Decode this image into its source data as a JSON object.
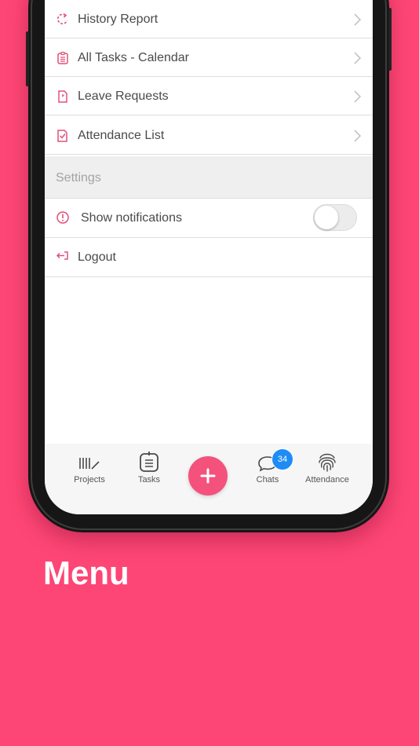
{
  "menu": {
    "items": [
      {
        "label": "History Report",
        "icon": "history-icon"
      },
      {
        "label": "All Tasks - Calendar",
        "icon": "calendar-icon"
      },
      {
        "label": "Leave Requests",
        "icon": "leave-document-icon"
      },
      {
        "label": "Attendance List",
        "icon": "checklist-icon"
      }
    ],
    "settings_header": "Settings",
    "notifications_label": "Show notifications",
    "notifications_enabled": false,
    "logout_label": "Logout"
  },
  "tabbar": {
    "projects_label": "Projects",
    "tasks_label": "Tasks",
    "add_icon": "plus-icon",
    "chats_label": "Chats",
    "chats_badge": "34",
    "attendance_label": "Attendance"
  },
  "caption": "Menu",
  "colors": {
    "background": "#fd4675",
    "accent": "#f4517c",
    "badge": "#1f8cf6",
    "icon_tint": "#e2507a"
  }
}
